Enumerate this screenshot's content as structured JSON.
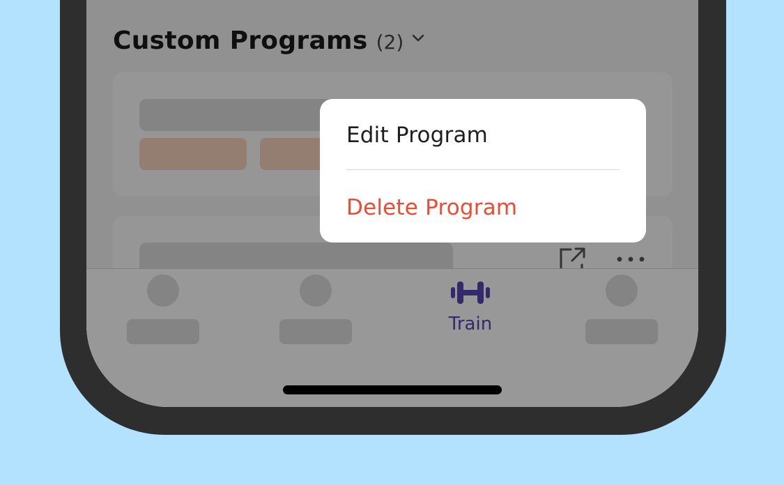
{
  "section": {
    "title": "Custom Programs",
    "count": "(2)"
  },
  "context_menu": {
    "edit_label": "Edit Program",
    "delete_label": "Delete Program"
  },
  "tab_bar": {
    "active_tab_label": "Train"
  },
  "colors": {
    "background": "#b3e2fe",
    "accent": "#5646b3",
    "destructive": "#f04a33",
    "skeleton_tag": "#f6d3bd"
  },
  "icons": {
    "section_toggle": "chevron-down-icon",
    "card_share": "share-icon",
    "card_more": "more-icon",
    "tab_train": "dumbbell-icon"
  }
}
